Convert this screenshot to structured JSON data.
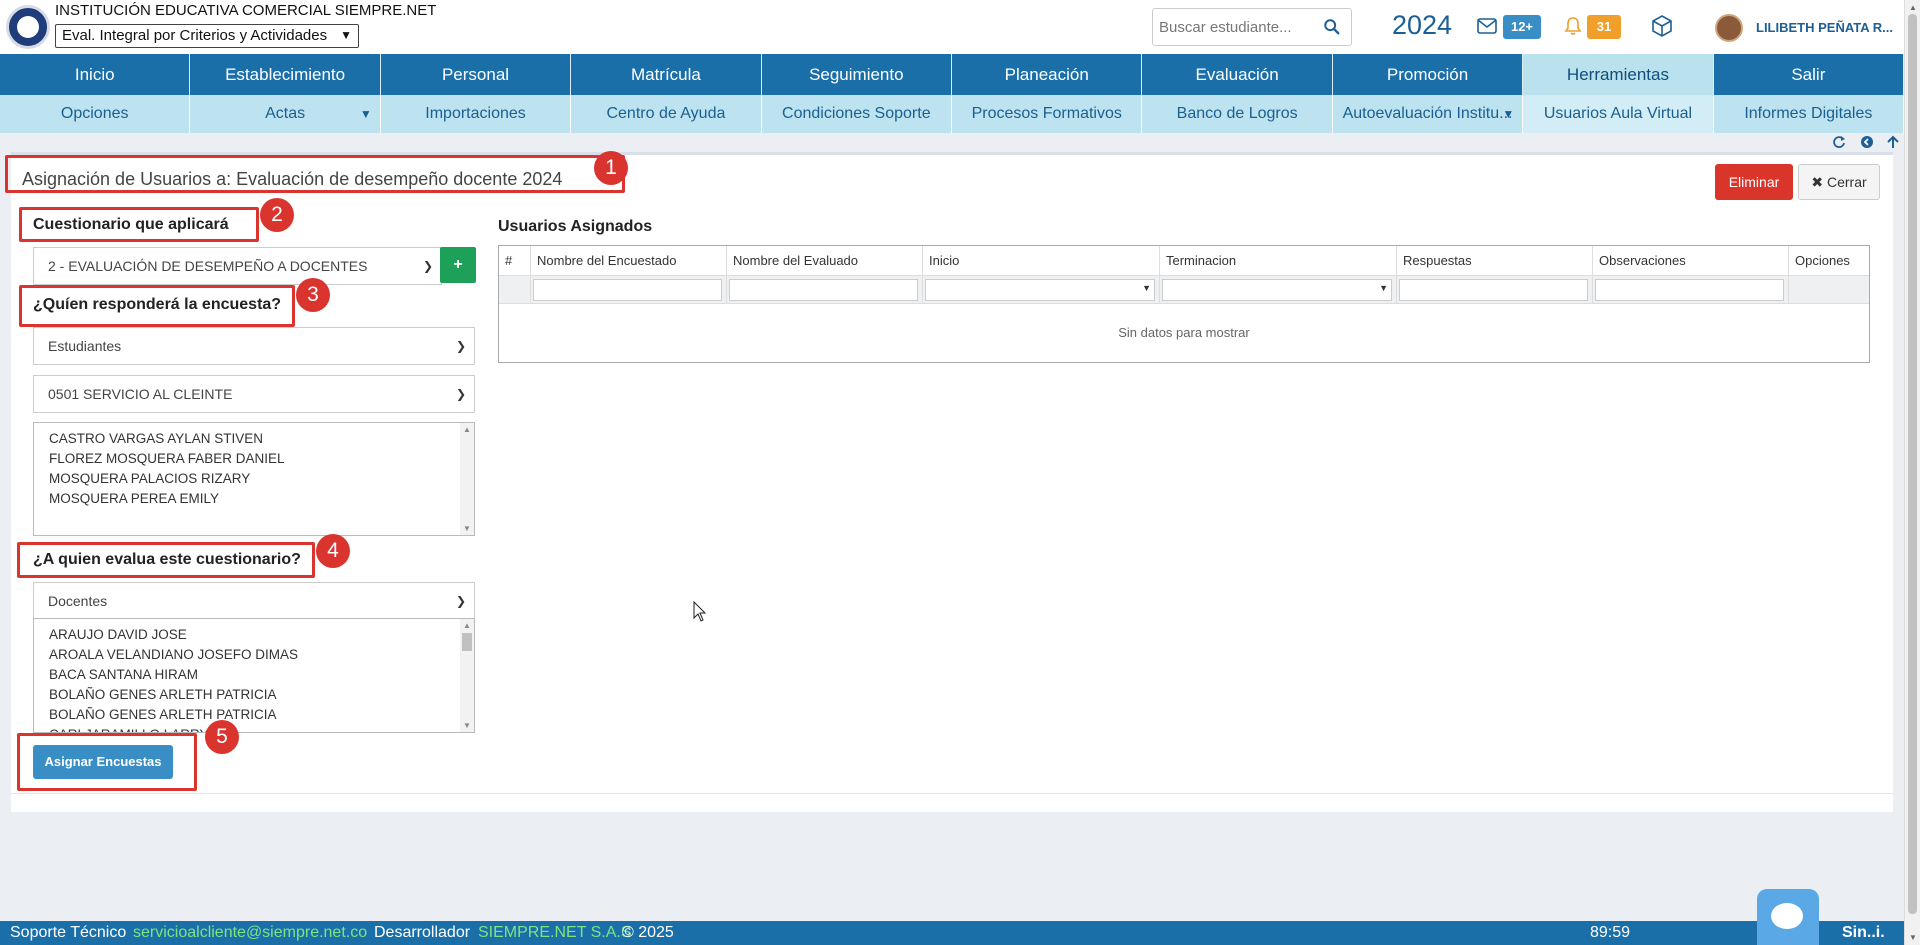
{
  "header": {
    "institution": "INSTITUCIÓN EDUCATIVA COMERCIAL SIEMPRE.NET",
    "profile_selected": "Eval. Integral por Criterios y Actividades",
    "search_placeholder": "Buscar estudiante...",
    "year": "2024",
    "messages_badge": "12+",
    "notifications_badge": "31",
    "user_name": "LILIBETH PEÑATA R..."
  },
  "menu": [
    {
      "label": "Inicio"
    },
    {
      "label": "Establecimiento"
    },
    {
      "label": "Personal"
    },
    {
      "label": "Matrícula"
    },
    {
      "label": "Seguimiento"
    },
    {
      "label": "Planeación"
    },
    {
      "label": "Evaluación"
    },
    {
      "label": "Promoción"
    },
    {
      "label": "Herramientas",
      "active": true
    },
    {
      "label": "Salir"
    }
  ],
  "submenu": [
    {
      "label": "Opciones"
    },
    {
      "label": "Actas",
      "caret": true
    },
    {
      "label": "Importaciones"
    },
    {
      "label": "Centro de Ayuda"
    },
    {
      "label": "Condiciones Soporte"
    },
    {
      "label": "Procesos Formativos"
    },
    {
      "label": "Banco de Logros"
    },
    {
      "label": "Autoevaluación Institu...",
      "caret": true
    },
    {
      "label": "Usuarios Aula Virtual",
      "active": true
    },
    {
      "label": "Informes Digitales"
    }
  ],
  "page": {
    "title": "Asignación de Usuarios a: Evaluación de desempeño docente 2024",
    "delete_button": "Eliminar",
    "close_button": "Cerrar"
  },
  "form": {
    "questionnaire_label": "Cuestionario que aplicará",
    "questionnaire_value": "2 - EVALUACIÓN DE DESEMPEÑO A DOCENTES",
    "add_button": "+",
    "respondent_label": "¿Quíen responderá la encuesta?",
    "respondent_type": "Estudiantes",
    "group_value": "0501 SERVICIO AL CLEINTE",
    "respondents": [
      "CASTRO VARGAS AYLAN STIVEN",
      "FLOREZ MOSQUERA FABER DANIEL",
      "MOSQUERA PALACIOS RIZARY",
      "MOSQUERA PEREA EMILY"
    ],
    "evaluated_label": "¿A quien evalua este cuestionario?",
    "evaluated_type": "Docentes",
    "evaluated": [
      "ARAUJO DAVID JOSE",
      "AROALA VELANDIANO JOSEFO DIMAS",
      "BACA SANTANA HIRAM",
      "BOLAÑO GENES ARLETH PATRICIA",
      "BOLAÑO GENES ARLETH PATRICIA",
      "CARLJARAMILLO LARRY"
    ],
    "assign_button": "Asignar Encuestas"
  },
  "grid": {
    "title": "Usuarios Asignados",
    "columns": [
      "#",
      "Nombre del Encuestado",
      "Nombre del Evaluado",
      "Inicio",
      "Terminacion",
      "Respuestas",
      "Observaciones",
      "Opciones"
    ],
    "empty_text": "Sin datos para mostrar"
  },
  "annotations": [
    "1",
    "2",
    "3",
    "4",
    "5"
  ],
  "footer": {
    "support_label": "Soporte Técnico",
    "support_email": "servicioalcliente@siempre.net.co",
    "developer_label": "Desarrollador",
    "developer_name": "SIEMPRE.NET S.A.S",
    "copyright": "© 2025",
    "timer": "89:59",
    "brand": "Sin..i."
  },
  "colors": {
    "menu_bg": "#1a6fa8",
    "submenu_bg": "#bde3f0",
    "delete_red": "#d9352a",
    "assign_blue": "#3a8ec6",
    "annotation_red": "#d9342e",
    "footer_link_green": "#7fe37f"
  }
}
